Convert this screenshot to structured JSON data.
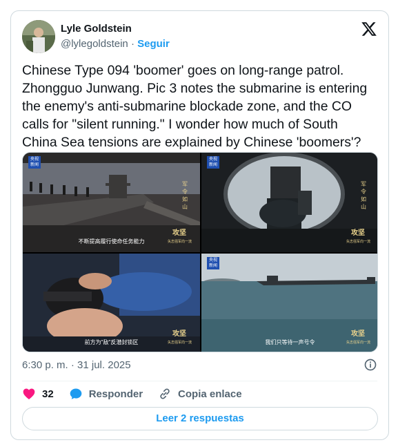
{
  "author": {
    "name": "Lyle Goldstein",
    "handle": "@lylegoldstein",
    "separator": "·",
    "follow_label": "Seguir"
  },
  "tweet": {
    "text": "Chinese Type 094 'boomer' goes on long-range patrol.\nZhongguo Junwang. Pic 3 notes the submarine is entering\nthe enemy's anti-submarine blockade zone, and the CO\ncalls for \"silent running.\" I wonder how much of South\nChina Sea tensions are explained by Chinese 'boomers'?",
    "timestamp": "6:30 p. m. · 31 jul. 2025"
  },
  "media": {
    "logo_line1": "央视",
    "logo_line2": "新闻",
    "tiles": [
      {
        "caption": "不断提高履行使命任务能力",
        "stamp": "攻坚",
        "stamp_sub": "矢志强军向一流",
        "vertical": "军令如山"
      },
      {
        "caption": "",
        "stamp": "攻坚",
        "stamp_sub": "矢志强军向一流",
        "vertical": "军令如山"
      },
      {
        "caption": "前方为\"敌\"反潜封锁区",
        "stamp": "攻坚",
        "stamp_sub": "矢志强军向一流",
        "vertical": ""
      },
      {
        "caption": "我们只等待一声号令",
        "stamp": "攻坚",
        "stamp_sub": "矢志强军向一流",
        "vertical": ""
      }
    ]
  },
  "actions": {
    "like_count": "32",
    "reply_label": "Responder",
    "copy_link_label": "Copia enlace",
    "read_replies_label": "Leer 2 respuestas"
  },
  "colors": {
    "accent": "#1d9bf0",
    "like": "#f91880",
    "secondary_text": "#536471"
  }
}
